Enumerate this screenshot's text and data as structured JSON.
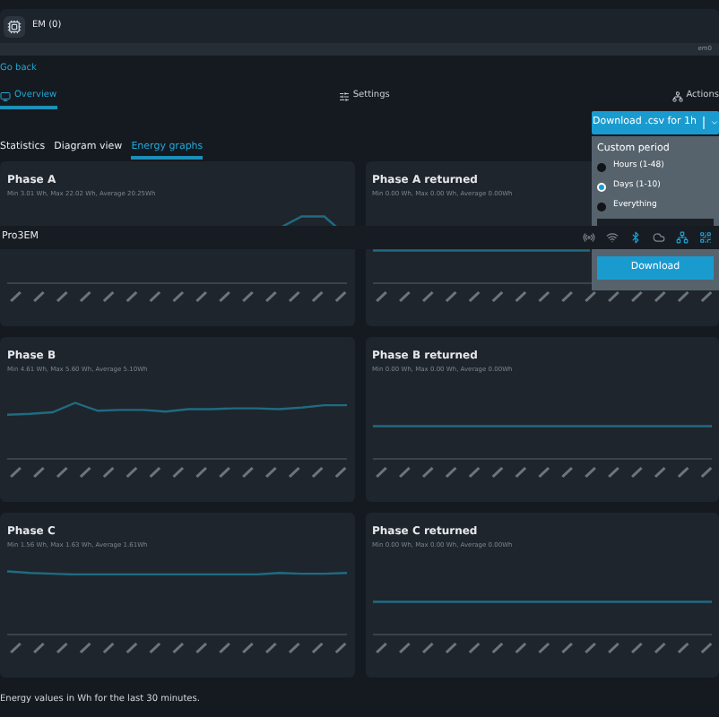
{
  "device": {
    "title": "EM (0)",
    "id_label": "em0"
  },
  "back_link": "Go back",
  "tabs": [
    {
      "label": "Overview",
      "selected": true
    },
    {
      "label": "Settings",
      "selected": false
    },
    {
      "label": "Actions",
      "selected": false
    }
  ],
  "download_button": {
    "label": "Download .csv for 1h"
  },
  "subtabs": [
    {
      "label": "Statistics",
      "selected": false
    },
    {
      "label": "Diagram view",
      "selected": false
    },
    {
      "label": "Energy graphs",
      "selected": true
    }
  ],
  "cards": [
    {
      "title": "Phase A",
      "stats": "Min 3.01 Wh, Max 22.02 Wh, Average 20.25Wh"
    },
    {
      "title": "Phase A returned",
      "stats": "Min 0.00 Wh, Max 0.00 Wh, Average 0.00Wh"
    },
    {
      "title": "Phase B",
      "stats": "Min 4.61 Wh, Max 5.60 Wh, Average 5.10Wh"
    },
    {
      "title": "Phase B returned",
      "stats": "Min 0.00 Wh, Max 0.00 Wh, Average 0.00Wh"
    },
    {
      "title": "Phase C",
      "stats": "Min 1.56 Wh, Max 1.63 Wh, Average 1.61Wh"
    },
    {
      "title": "Phase C returned",
      "stats": "Min 0.00 Wh, Max 0.00 Wh, Average 0.00Wh"
    }
  ],
  "footer": "Energy values in Wh for the last 30 minutes.",
  "overlay_bar": {
    "title": "Pro3EM",
    "status_icons": [
      {
        "on": false
      },
      {
        "on": false
      },
      {
        "on": true
      },
      {
        "on": false
      },
      {
        "on": true
      },
      {
        "on": true
      }
    ]
  },
  "period_menu": {
    "heading": "Custom period",
    "options": [
      {
        "label": "Hours (1-48)",
        "selected": false
      },
      {
        "label": "Days (1-10)",
        "selected": true
      },
      {
        "label": "Everything",
        "selected": false
      }
    ],
    "button": "Download"
  }
}
